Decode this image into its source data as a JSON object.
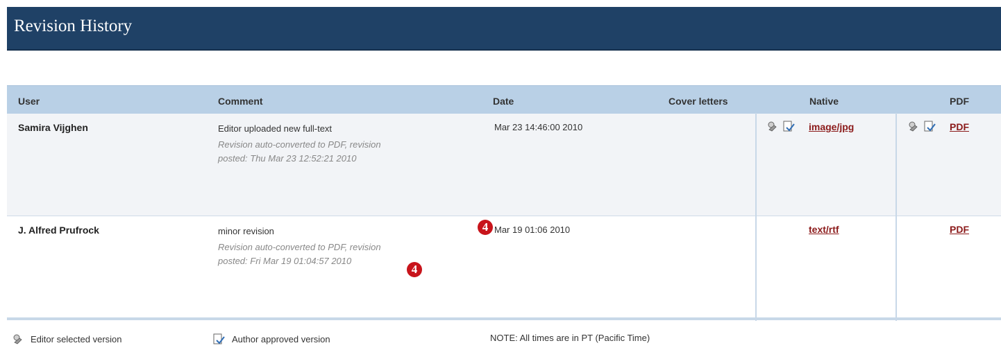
{
  "title": "Revision History",
  "columns": {
    "user": "User",
    "comment": "Comment",
    "date": "Date",
    "cover_letters": "Cover letters",
    "native": "Native",
    "pdf": "PDF"
  },
  "rows": [
    {
      "user": "Samira Vijghen",
      "comment": "Editor uploaded new full-text",
      "note": "Revision auto-converted to PDF, revision posted: Thu Mar 23 12:52:21 2010",
      "date": "Mar 23 14:46:00 2010",
      "native": "image/jpg",
      "pdf": "PDF",
      "icons": [
        "editor-selected-icon",
        "author-approved-icon"
      ]
    },
    {
      "user": "J. Alfred Prufrock",
      "comment": "minor revision",
      "note": "Revision auto-converted to PDF, revision posted: Fri Mar 19 01:04:57 2010",
      "date": "Mar 19 01:06 2010",
      "native": "text/rtf",
      "pdf": "PDF",
      "icons": []
    }
  ],
  "badges": [
    "4",
    "4"
  ],
  "legend": {
    "editor_selected": "Editor selected version",
    "author_approved": "Author approved version",
    "note": "NOTE: All times are in PT (Pacific Time)"
  },
  "colors": {
    "header": "#1f4166",
    "table_header": "#b9d0e6",
    "link": "#8b1a1a",
    "badge": "#c8141b"
  }
}
